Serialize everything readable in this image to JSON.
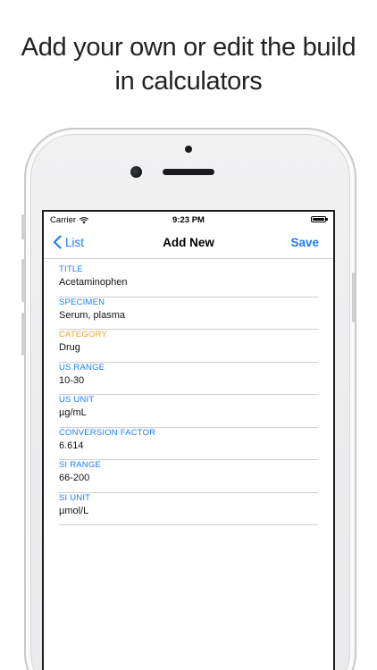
{
  "headline": {
    "line1": "Add your own or edit the build",
    "line2": "in calculators"
  },
  "status_bar": {
    "carrier": "Carrier",
    "time": "9:23 PM"
  },
  "nav": {
    "back_label": "List",
    "title": "Add New",
    "save_label": "Save"
  },
  "colors": {
    "accent": "#1a7ef5",
    "label_blue": "#1a7ef5",
    "label_orange": "#e8a230"
  },
  "fields": [
    {
      "label": "TITLE",
      "value": "Acetaminophen",
      "label_color": "blue"
    },
    {
      "label": "SPECIMEN",
      "value": "Serum, plasma",
      "label_color": "blue"
    },
    {
      "label": "CATEGORY",
      "value": "Drug",
      "label_color": "orange"
    },
    {
      "label": "US RANGE",
      "value": "10-30",
      "label_color": "blue"
    },
    {
      "label": "US UNIT",
      "value": "µg/mL",
      "label_color": "blue"
    },
    {
      "label": "CONVERSION FACTOR",
      "value": "6.614",
      "label_color": "blue"
    },
    {
      "label": "SI RANGE",
      "value": "66-200",
      "label_color": "blue"
    },
    {
      "label": "SI UNIT",
      "value": "µmol/L",
      "label_color": "blue"
    }
  ]
}
